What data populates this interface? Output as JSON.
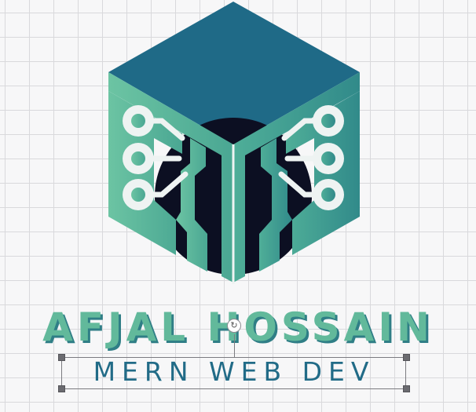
{
  "canvas": {
    "background": "#f7f7f8",
    "grid_color": "#d9d9dc"
  },
  "logo": {
    "icon": "circuit-cube-icon",
    "colors": {
      "top_face": "#1e6a86",
      "side_face": "#62b99b",
      "side_face_dark": "#2f8f8c",
      "core": "#0c0f22",
      "trace": "#eef3f2"
    }
  },
  "text": {
    "name": "AFJAL HOSSAIN",
    "name_color": "#62b99b",
    "name_shadow": "#2f7e86",
    "subtitle": "MERN WEB DEV",
    "subtitle_color": "#216b87"
  },
  "selection": {
    "rotate_icon": "rotate-icon",
    "handle_color": "#6b6b70"
  }
}
